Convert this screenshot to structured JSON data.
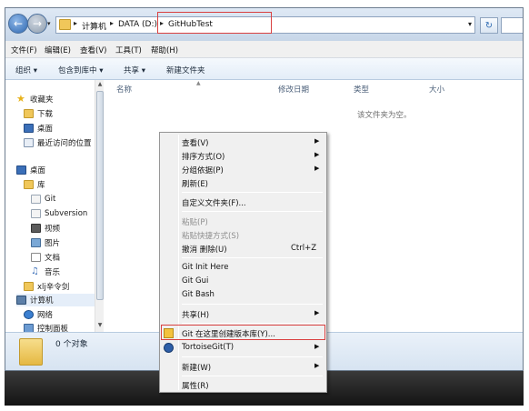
{
  "address_bar": {
    "breadcrumbs": [
      "计算机",
      "DATA (D:)",
      "GitHubTest"
    ]
  },
  "menubar": {
    "items": [
      "文件(F)",
      "编辑(E)",
      "查看(V)",
      "工具(T)",
      "帮助(H)"
    ]
  },
  "toolbar": {
    "organize": "组织 ▾",
    "include_in_library": "包含到库中 ▾",
    "share": "共享 ▾",
    "new_folder": "新建文件夹"
  },
  "nav_pane": {
    "favorites": "收藏夹",
    "downloads": "下载",
    "desktop_fav": "桌面",
    "recent": "最近访问的位置",
    "desktop": "桌面",
    "libraries": "库",
    "git": "Git",
    "subversion": "Subversion",
    "videos": "视频",
    "pictures": "图片",
    "documents": "文档",
    "music": "音乐",
    "user": "xlj辛令剑",
    "computer": "计算机",
    "network": "网络",
    "control_panel": "控制面板"
  },
  "content": {
    "columns": [
      "名称",
      "修改日期",
      "类型",
      "大小"
    ],
    "empty_message": "该文件夹为空。"
  },
  "details_pane": {
    "item_count": "0 个对象"
  },
  "context_menu": {
    "view": "查看(V)",
    "sort_by": "排序方式(O)",
    "group_by": "分组依据(P)",
    "refresh": "刷新(E)",
    "customize": "自定义文件夹(F)...",
    "paste": "粘贴(P)",
    "paste_shortcut": "粘贴快捷方式(S)",
    "undo_delete": "撤消 删除(U)",
    "undo_shortcut": "Ctrl+Z",
    "git_init": "Git Init Here",
    "git_gui": "Git Gui",
    "git_bash": "Git Bash",
    "share": "共享(H)",
    "git_create_repo": "Git 在这里创建版本库(Y)...",
    "tortoisegit": "TortoiseGit(T)",
    "new": "新建(W)",
    "properties": "属性(R)"
  }
}
